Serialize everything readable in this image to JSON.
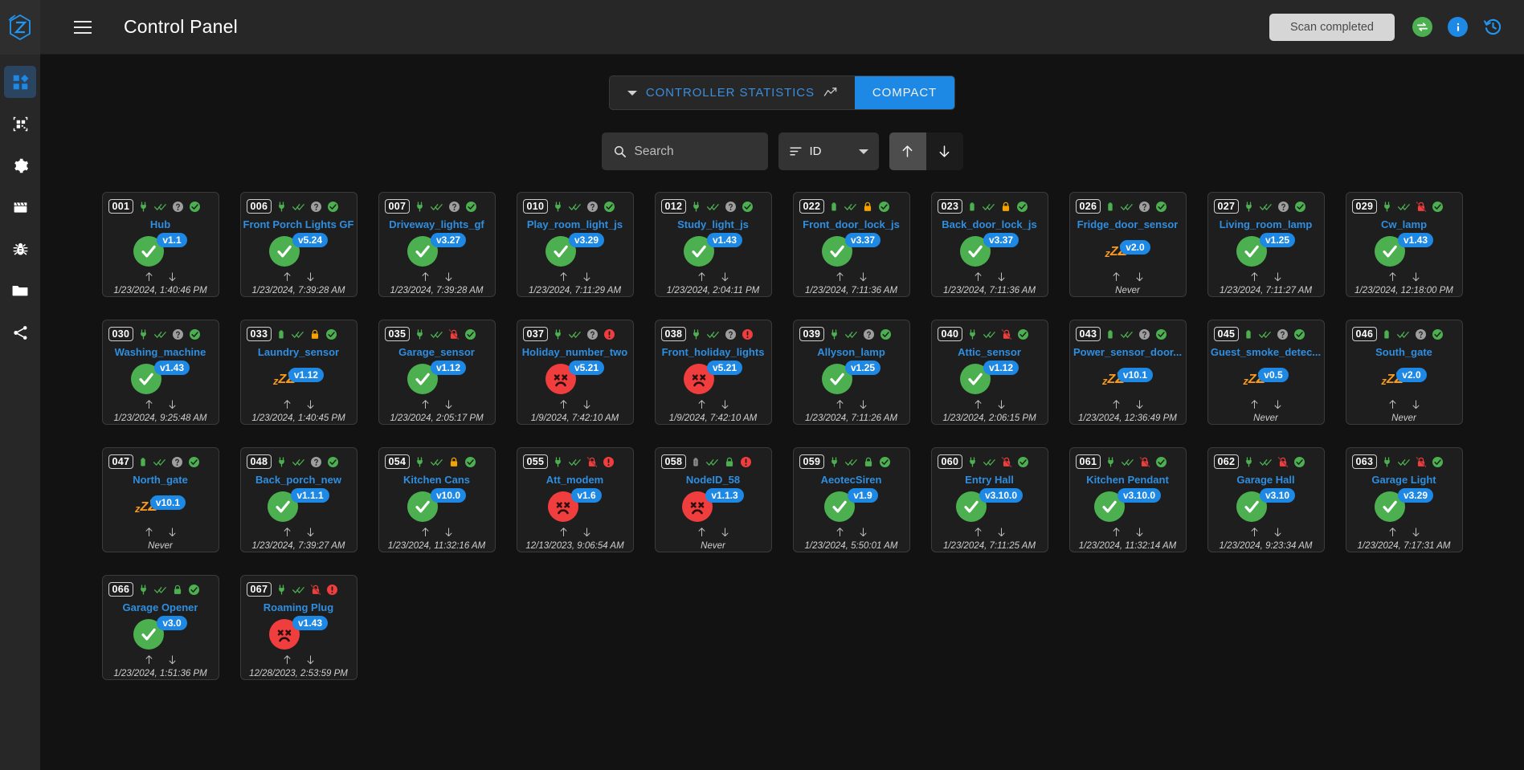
{
  "app": {
    "title": "Control Panel",
    "logo_icon": "zwave-logo-icon",
    "menu_icon": "hamburger-menu-icon",
    "scan_status": "Scan completed",
    "sync_icon": "sync-arrows-icon",
    "info_icon": "info-icon",
    "history_icon": "history-icon"
  },
  "sidebar": {
    "items": [
      {
        "name": "dashboard",
        "icon": "dashboard-grid-icon",
        "active": true
      },
      {
        "name": "smart-start",
        "icon": "qr-code-icon",
        "active": false
      },
      {
        "name": "settings",
        "icon": "gear-icon",
        "active": false
      },
      {
        "name": "scenes",
        "icon": "clapperboard-icon",
        "active": false
      },
      {
        "name": "debug",
        "icon": "bug-icon",
        "active": false
      },
      {
        "name": "store",
        "icon": "folder-icon",
        "active": false
      },
      {
        "name": "network-graph",
        "icon": "share-nodes-icon",
        "active": false
      }
    ]
  },
  "tabs": [
    {
      "label": "CONTROLLER STATISTICS",
      "icon": "chart-line-icon",
      "active": false,
      "caret": true
    },
    {
      "label": "COMPACT",
      "icon": "",
      "active": true,
      "caret": false
    }
  ],
  "toolbar": {
    "search_placeholder": "Search",
    "search_value": "",
    "search_icon": "search-icon",
    "sort_label": "ID",
    "sort_icon": "sort-lines-icon",
    "sort_caret_icon": "chevron-down-icon",
    "asc_icon": "arrow-up-icon",
    "desc_icon": "arrow-down-icon",
    "asc_selected": true
  },
  "colors": {
    "accent_blue": "#1e88e5",
    "link_blue": "#2f8ee0",
    "ok_green": "#4caf50",
    "dead_red": "#f03d3d",
    "sleep_orange": "#f79a1f",
    "lock_amber": "#f5a302",
    "unknown_gray": "#9e9e9e",
    "panel_bg": "#1e1e1e",
    "page_bg": "#121212",
    "bar_bg": "#272727"
  },
  "nodes": [
    {
      "id": "001",
      "name": "Hub",
      "power": "plug",
      "reach": "double-check",
      "security": "unknown",
      "health": "ok",
      "status": "ok",
      "version": "v1.1",
      "time": "1/23/2024, 1:40:46 PM"
    },
    {
      "id": "006",
      "name": "Front Porch Lights GF",
      "power": "plug",
      "reach": "double-check",
      "security": "unknown",
      "health": "ok",
      "status": "ok",
      "version": "v5.24",
      "time": "1/23/2024, 7:39:28 AM"
    },
    {
      "id": "007",
      "name": "Driveway_lights_gf",
      "power": "plug",
      "reach": "double-check",
      "security": "unknown",
      "health": "ok",
      "status": "ok",
      "version": "v3.27",
      "time": "1/23/2024, 7:39:28 AM"
    },
    {
      "id": "010",
      "name": "Play_room_light_js",
      "power": "plug",
      "reach": "double-check",
      "security": "unknown",
      "health": "ok",
      "status": "ok",
      "version": "v3.29",
      "time": "1/23/2024, 7:11:29 AM"
    },
    {
      "id": "012",
      "name": "Study_light_js",
      "power": "plug",
      "reach": "double-check",
      "security": "unknown",
      "health": "ok",
      "status": "ok",
      "version": "v1.43",
      "time": "1/23/2024, 2:04:11 PM"
    },
    {
      "id": "022",
      "name": "Front_door_lock_js",
      "power": "battery",
      "reach": "double-check",
      "security": "locked",
      "health": "ok",
      "status": "ok",
      "version": "v3.37",
      "time": "1/23/2024, 7:11:36 AM"
    },
    {
      "id": "023",
      "name": "Back_door_lock_js",
      "power": "battery",
      "reach": "double-check",
      "security": "locked",
      "health": "ok",
      "status": "ok",
      "version": "v3.37",
      "time": "1/23/2024, 7:11:36 AM"
    },
    {
      "id": "026",
      "name": "Fridge_door_sensor",
      "power": "battery",
      "reach": "double-check",
      "security": "unknown",
      "health": "ok",
      "status": "sleep",
      "version": "v2.0",
      "time": "Never"
    },
    {
      "id": "027",
      "name": "Living_room_lamp",
      "power": "plug",
      "reach": "double-check",
      "security": "unknown",
      "health": "ok",
      "status": "ok",
      "version": "v1.25",
      "time": "1/23/2024, 7:11:27 AM"
    },
    {
      "id": "029",
      "name": "Cw_lamp",
      "power": "plug",
      "reach": "double-check",
      "security": "unlocked",
      "health": "ok",
      "status": "ok",
      "version": "v1.43",
      "time": "1/23/2024, 12:18:00 PM"
    },
    {
      "id": "030",
      "name": "Washing_machine",
      "power": "plug",
      "reach": "double-check",
      "security": "unknown",
      "health": "ok",
      "status": "ok",
      "version": "v1.43",
      "time": "1/23/2024, 9:25:48 AM"
    },
    {
      "id": "033",
      "name": "Laundry_sensor",
      "power": "battery",
      "reach": "double-check",
      "security": "locked",
      "health": "ok",
      "status": "sleep",
      "version": "v1.12",
      "time": "1/23/2024, 1:40:45 PM"
    },
    {
      "id": "035",
      "name": "Garage_sensor",
      "power": "plug",
      "reach": "double-check",
      "security": "unlocked",
      "health": "ok",
      "status": "ok",
      "version": "v1.12",
      "time": "1/23/2024, 2:05:17 PM"
    },
    {
      "id": "037",
      "name": "Holiday_number_two",
      "power": "plug",
      "reach": "double-check",
      "security": "unknown",
      "health": "alert",
      "status": "dead",
      "version": "v5.21",
      "time": "1/9/2024, 7:42:10 AM"
    },
    {
      "id": "038",
      "name": "Front_holiday_lights",
      "power": "plug",
      "reach": "double-check",
      "security": "unknown",
      "health": "alert",
      "status": "dead",
      "version": "v5.21",
      "time": "1/9/2024, 7:42:10 AM"
    },
    {
      "id": "039",
      "name": "Allyson_lamp",
      "power": "plug",
      "reach": "double-check",
      "security": "unknown",
      "health": "ok",
      "status": "ok",
      "version": "v1.25",
      "time": "1/23/2024, 7:11:26 AM"
    },
    {
      "id": "040",
      "name": "Attic_sensor",
      "power": "plug",
      "reach": "double-check",
      "security": "unlocked",
      "health": "ok",
      "status": "ok",
      "version": "v1.12",
      "time": "1/23/2024, 2:06:15 PM"
    },
    {
      "id": "043",
      "name": "Power_sensor_door...",
      "power": "battery",
      "reach": "double-check",
      "security": "unknown",
      "health": "ok",
      "status": "sleep",
      "version": "v10.1",
      "time": "1/23/2024, 12:36:49 PM"
    },
    {
      "id": "045",
      "name": "Guest_smoke_detec...",
      "power": "battery",
      "reach": "double-check",
      "security": "unknown",
      "health": "ok",
      "status": "sleep",
      "version": "v0.5",
      "time": "Never"
    },
    {
      "id": "046",
      "name": "South_gate",
      "power": "battery",
      "reach": "double-check",
      "security": "unknown",
      "health": "ok",
      "status": "sleep",
      "version": "v2.0",
      "time": "Never"
    },
    {
      "id": "047",
      "name": "North_gate",
      "power": "battery",
      "reach": "double-check",
      "security": "unknown",
      "health": "ok",
      "status": "sleep",
      "version": "v10.1",
      "time": "Never"
    },
    {
      "id": "048",
      "name": "Back_porch_new",
      "power": "plug",
      "reach": "double-check",
      "security": "unknown",
      "health": "ok",
      "status": "ok",
      "version": "v1.1.1",
      "time": "1/23/2024, 7:39:27 AM"
    },
    {
      "id": "054",
      "name": "Kitchen Cans",
      "power": "plug",
      "reach": "double-check",
      "security": "locked",
      "health": "ok",
      "status": "ok",
      "version": "v10.0",
      "time": "1/23/2024, 11:32:16 AM"
    },
    {
      "id": "055",
      "name": "Att_modem",
      "power": "plug",
      "reach": "double-check",
      "security": "unlocked",
      "health": "alert",
      "status": "dead",
      "version": "v1.6",
      "time": "12/13/2023, 9:06:54 AM"
    },
    {
      "id": "058",
      "name": "NodeID_58",
      "power": "battery-dim",
      "reach": "double-check",
      "security": "locked",
      "health": "alert",
      "status": "dead",
      "version": "v1.1.3",
      "time": "Never"
    },
    {
      "id": "059",
      "name": "AeotecSiren",
      "power": "plug",
      "reach": "double-check",
      "security": "locked",
      "health": "ok",
      "status": "ok",
      "version": "v1.9",
      "time": "1/23/2024, 5:50:01 AM"
    },
    {
      "id": "060",
      "name": "Entry Hall",
      "power": "plug",
      "reach": "double-check",
      "security": "unlocked",
      "health": "ok",
      "status": "ok",
      "version": "v3.10.0",
      "time": "1/23/2024, 7:11:25 AM"
    },
    {
      "id": "061",
      "name": "Kitchen Pendant",
      "power": "plug",
      "reach": "double-check",
      "security": "unlocked",
      "health": "ok",
      "status": "ok",
      "version": "v3.10.0",
      "time": "1/23/2024, 11:32:14 AM"
    },
    {
      "id": "062",
      "name": "Garage Hall",
      "power": "plug",
      "reach": "double-check",
      "security": "unlocked",
      "health": "ok",
      "status": "ok",
      "version": "v3.10",
      "time": "1/23/2024, 9:23:34 AM"
    },
    {
      "id": "063",
      "name": "Garage Light",
      "power": "plug",
      "reach": "double-check",
      "security": "unlocked",
      "health": "ok",
      "status": "ok",
      "version": "v3.29",
      "time": "1/23/2024, 7:17:31 AM"
    },
    {
      "id": "066",
      "name": "Garage Opener",
      "power": "plug",
      "reach": "double-check",
      "security": "locked",
      "health": "ok",
      "status": "ok",
      "version": "v3.0",
      "time": "1/23/2024, 1:51:36 PM"
    },
    {
      "id": "067",
      "name": "Roaming Plug",
      "power": "plug",
      "reach": "double-check",
      "security": "unlocked",
      "health": "alert",
      "status": "dead",
      "version": "v1.43",
      "time": "12/28/2023, 2:53:59 PM"
    }
  ]
}
